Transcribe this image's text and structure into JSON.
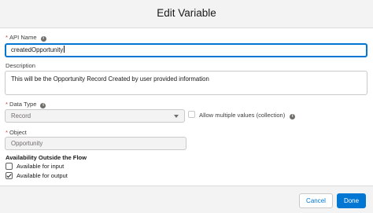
{
  "modal": {
    "title": "Edit Variable"
  },
  "fields": {
    "api_name": {
      "label": "API Name",
      "required": "*",
      "value": "createdOpportunity"
    },
    "description": {
      "label": "Description",
      "value": "This will be the Opportunity Record Created by user provided information"
    },
    "data_type": {
      "label": "Data Type",
      "required": "*",
      "value": "Record"
    },
    "multiple": {
      "label": "Allow multiple values (collection)",
      "checked": false
    },
    "object": {
      "label": "Object",
      "required": "*",
      "value": "Opportunity"
    }
  },
  "availability": {
    "heading": "Availability Outside the Flow",
    "input_label": "Available for input",
    "input_checked": false,
    "output_label": "Available for output",
    "output_checked": true
  },
  "footer": {
    "cancel_label": "Cancel",
    "done_label": "Done"
  },
  "icons": {
    "info": "info-icon",
    "dropdown": "chevron-down-icon",
    "check": "checkmark-icon"
  },
  "colors": {
    "brand": "#0176d3",
    "required": "#c23934",
    "header_bg": "#f3f3f3"
  }
}
